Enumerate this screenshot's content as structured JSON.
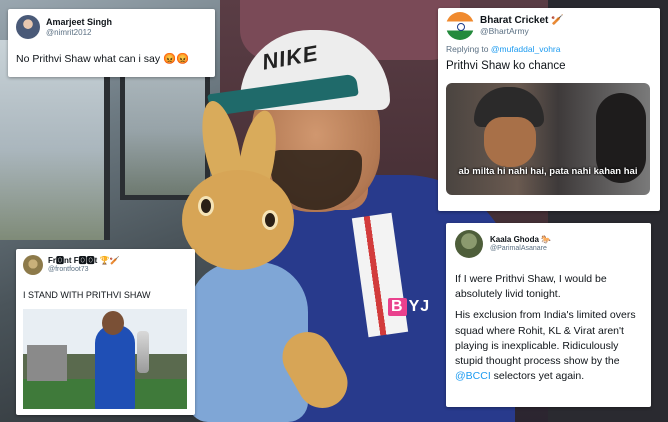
{
  "tweets": [
    {
      "name": "Amarjeet Singh",
      "handle": "@nimrit2012",
      "text": "No Prithvi Shaw what can i say 😡😡"
    },
    {
      "name": "Bharat Cricket 🏏",
      "handle": "@BhartArmy",
      "reply_prefix": "Replying to ",
      "reply_to": "@mufaddal_vohra",
      "text": "Prithvi Shaw ko chance",
      "media_caption": "ab milta hi nahi hai, pata nahi kahan hai"
    },
    {
      "name": "Fr🅾nt F🅾🅾t 🏆🏏",
      "handle": "@frontfoot73",
      "text": "I STAND WITH PRITHVI SHAW"
    },
    {
      "name": "Kaala Ghoda 🐎",
      "handle": "@ParimalAsanare",
      "text_p1": "If I were Prithvi Shaw, I would be absolutely livid tonight.",
      "text_p2_before": "His exclusion from India's limited overs squad where Rohit, KL & Virat aren't playing is inexplicable. Ridiculously stupid thought process show by the ",
      "text_p2_mention": "@BCCI",
      "text_p2_after": " selectors yet again."
    }
  ],
  "photo": {
    "cap_logo": "NIKE",
    "jersey_sponsor_letter": "B",
    "jersey_sponsor_rest": "YJ"
  }
}
